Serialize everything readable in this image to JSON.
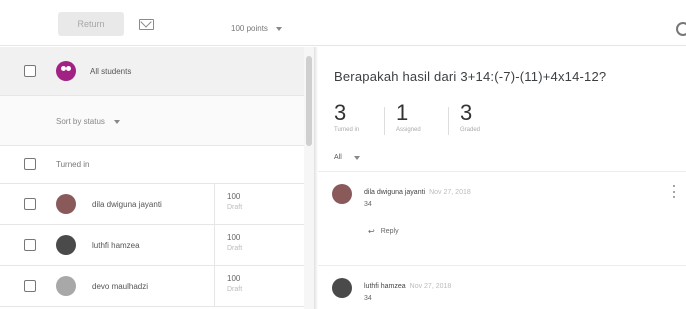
{
  "toolbar": {
    "return_label": "Return",
    "mail_icon": "mail-icon",
    "points_label": "100 points",
    "settings_icon": "settings-icon"
  },
  "left_panel": {
    "all_students_label": "All students",
    "sort_label": "Sort by status",
    "turned_in_label": "Turned in",
    "students": [
      {
        "name": "dila dwiguna jayanti",
        "grade": "100",
        "status": "Draft",
        "avatar_color": "#8a5a5a"
      },
      {
        "name": "luthfi hamzea",
        "grade": "100",
        "status": "Draft",
        "avatar_color": "#4a4a4a"
      },
      {
        "name": "devo maulhadzi",
        "grade": "100",
        "status": "Draft",
        "avatar_color": "#a8a8a8"
      }
    ]
  },
  "right_panel": {
    "question": "Berapakah hasil dari 3+14:(-7)-(11)+4x14-12?",
    "stats": [
      {
        "value": "3",
        "label": "Turned in"
      },
      {
        "value": "1",
        "label": "Assigned"
      },
      {
        "value": "3",
        "label": "Graded"
      }
    ],
    "filter_label": "All",
    "comments": [
      {
        "name": "dila dwiguna jayanti",
        "date": "Nov 27, 2018",
        "text": "34",
        "reply_label": "Reply",
        "avatar_color": "#8a5a5a"
      },
      {
        "name": "luthfi hamzea",
        "date": "Nov 27, 2018",
        "text": "34",
        "avatar_color": "#4a4a4a"
      }
    ]
  },
  "colors": {
    "accent": "#a12283",
    "border": "#e6e6e6"
  }
}
